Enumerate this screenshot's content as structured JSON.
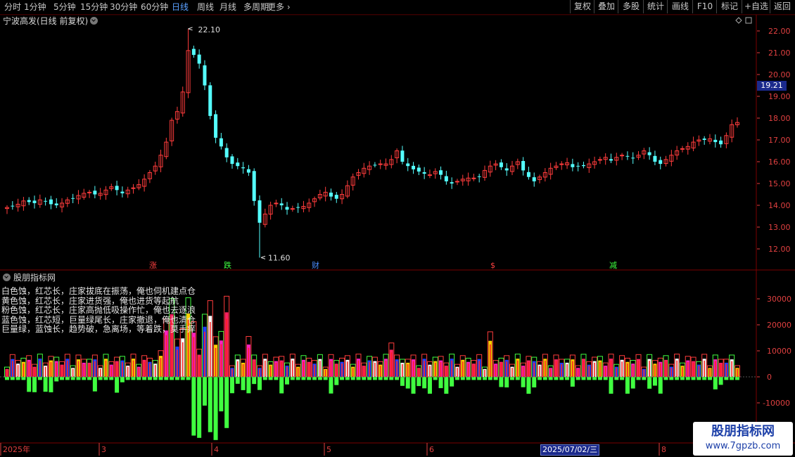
{
  "toolbar": {
    "periods": [
      "分时",
      "1分钟",
      "5分钟",
      "15分钟",
      "30分钟",
      "60分钟",
      "日线",
      "周线",
      "月线",
      "多周期",
      "更多"
    ],
    "active_period": "日线",
    "right_buttons": [
      "复权",
      "叠加",
      "多股",
      "统计",
      "画线",
      "F10",
      "标记",
      "+自选",
      "返回"
    ]
  },
  "stock": {
    "title": "宁波高发(日线 前复权)"
  },
  "indicator": {
    "title": "股朋指标网",
    "legend": [
      "白色蚀，红芯长，庄家拔底在振荡，俺也伺机建点仓",
      "黄色蚀，红芯长，庄家进货强，俺也进货等起航",
      "粉色蚀，红芯长，庄家高抛低吸操作忙，俺也去逐浪",
      "蓝色蚀，红芯短，巨量绿尾长，庄家撤退，俺也清仓",
      "巨量绿，蓝蚀长，趋势破，急离场，等着跌，莫手痒"
    ]
  },
  "price_axis": {
    "labels": [
      "22.00",
      "21.00",
      "20.00",
      "19.00",
      "18.00",
      "17.00",
      "16.00",
      "15.00",
      "14.00",
      "13.00",
      "12.00"
    ],
    "current_price": "19.21"
  },
  "volume_axis": {
    "labels": [
      "30000",
      "20000",
      "10000",
      "0",
      "-10000"
    ]
  },
  "time_axis": {
    "labels": [
      "2025年",
      "3",
      "4",
      "5",
      "6",
      "8"
    ],
    "cursor_date": "2025/07/02/三"
  },
  "annotations": {
    "high": "22.10",
    "low": "11.60"
  },
  "events": [
    {
      "label": "涨",
      "color": "#ff4040"
    },
    {
      "label": "跌",
      "color": "#40ff40"
    },
    {
      "label": "财",
      "color": "#4a8cff"
    },
    {
      "label": "$",
      "color": "#ff4040"
    },
    {
      "label": "减",
      "color": "#40ff40"
    }
  ],
  "watermark": {
    "line1": "股朋指标网",
    "line2": "www.7gpzb.com"
  },
  "colors": {
    "up": "#ff3c3c",
    "down": "#54ffff",
    "axis": "#e04040",
    "grid": "#5a0000",
    "active": "#5aa0ff"
  },
  "chart_data": {
    "type": "candlestick",
    "price_range": [
      11.4,
      22.4
    ],
    "high": 22.1,
    "low": 11.6,
    "closes": [
      13.9,
      13.95,
      14.05,
      14.2,
      14.15,
      14.1,
      14.25,
      14.2,
      14.05,
      14.0,
      14.1,
      14.25,
      14.3,
      14.45,
      14.55,
      14.6,
      14.5,
      14.55,
      14.7,
      14.85,
      14.7,
      14.55,
      14.7,
      14.8,
      14.95,
      15.2,
      15.5,
      15.8,
      16.3,
      16.9,
      17.9,
      18.3,
      19.2,
      21.1,
      20.9,
      20.5,
      19.5,
      18.1,
      17.1,
      16.7,
      16.2,
      15.9,
      15.8,
      15.7,
      15.5,
      14.2,
      13.2,
      13.6,
      14.0,
      14.1,
      14.0,
      13.8,
      13.85,
      13.9,
      13.95,
      14.1,
      14.3,
      14.5,
      14.6,
      14.4,
      14.3,
      14.5,
      14.9,
      15.3,
      15.5,
      15.7,
      15.8,
      15.85,
      15.9,
      15.9,
      16.1,
      16.5,
      16.0,
      15.8,
      15.65,
      15.55,
      15.45,
      15.4,
      15.55,
      15.4,
      15.1,
      15.0,
      15.1,
      15.2,
      15.25,
      15.25,
      15.3,
      15.6,
      15.8,
      15.9,
      15.75,
      15.6,
      15.8,
      16.0,
      15.6,
      15.3,
      15.1,
      15.3,
      15.5,
      15.7,
      15.8,
      15.9,
      15.95,
      15.75,
      15.8,
      15.8,
      15.9,
      16.0,
      16.1,
      16.2,
      16.05,
      16.2,
      16.3,
      16.25,
      16.15,
      16.3,
      16.5,
      16.3,
      16.0,
      15.9,
      16.1,
      16.3,
      16.5,
      16.6,
      16.7,
      16.9,
      17.0,
      17.0,
      17.05,
      16.9,
      16.8,
      17.2,
      17.7,
      17.8
    ]
  }
}
